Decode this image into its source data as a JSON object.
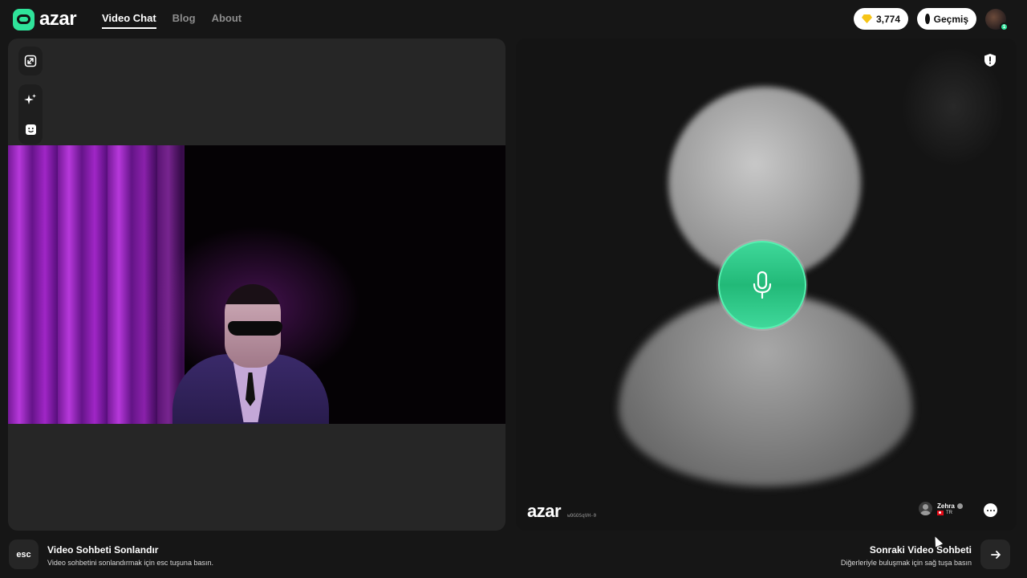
{
  "header": {
    "logo_text": "azar",
    "nav": [
      {
        "label": "Video Chat",
        "active": true
      },
      {
        "label": "Blog",
        "active": false
      },
      {
        "label": "About",
        "active": false
      }
    ],
    "gems": "3,774",
    "history_label": "Geçmiş",
    "avatar_badge": "1"
  },
  "left_panel": {
    "tools": [
      "expand-icon",
      "sparkle-effects-icon",
      "face-filter-icon"
    ]
  },
  "right_panel": {
    "watermark_logo": "azar",
    "watermark_id": "wOGOSqVH-0",
    "partner": {
      "name": "Zehra",
      "country": "TR"
    },
    "mic_icon": "microphone-icon",
    "shield_icon": "report-shield-icon",
    "chat_icon": "chat-bubble-icon"
  },
  "footer": {
    "esc_key": "esc",
    "end_title": "Video Sohbeti Sonlandır",
    "end_sub": "Video sohbetini sonlandırmak için esc tuşuna basın.",
    "next_title": "Sonraki Video Sohbeti",
    "next_sub": "Diğerleriyle buluşmak için sağ tuşa basın"
  },
  "colors": {
    "accent": "#2fe39a",
    "background": "#161616",
    "panel": "#262626",
    "gem": "#f6c416"
  }
}
